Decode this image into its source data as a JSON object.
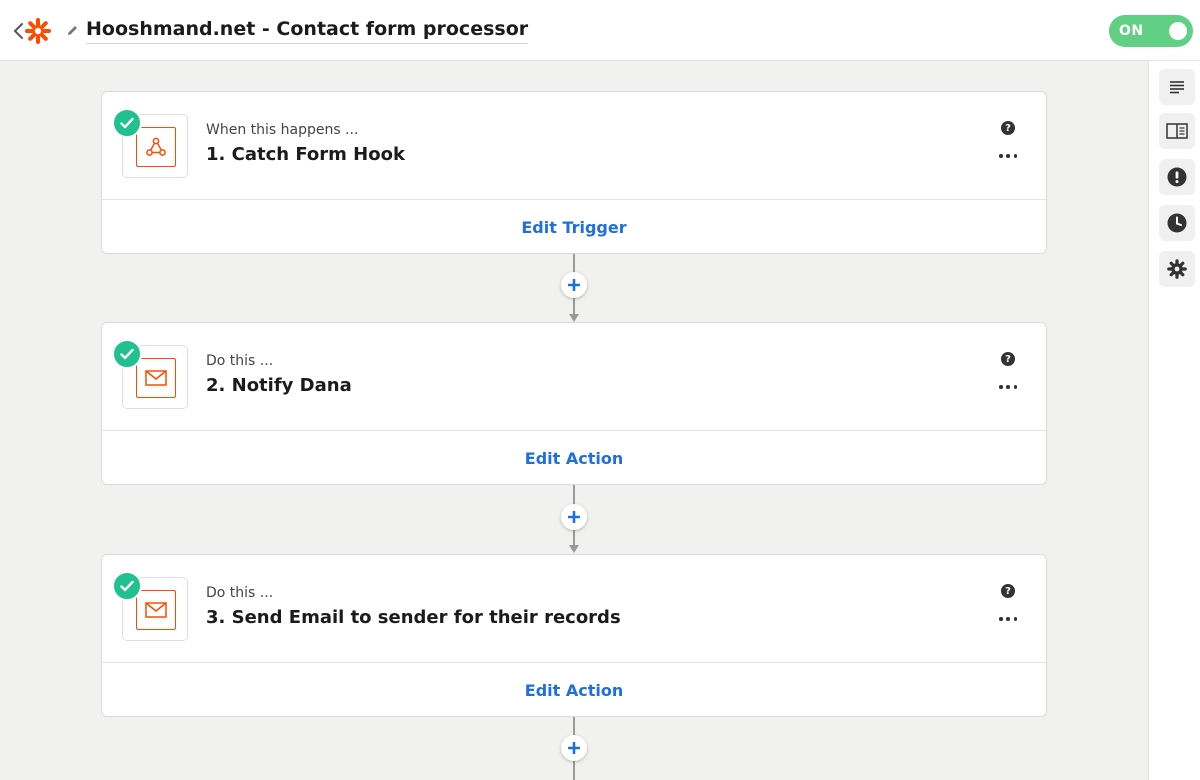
{
  "header": {
    "title": "Hooshmand.net - Contact form processor",
    "toggle_label": "ON"
  },
  "colors": {
    "brand": "#ff4a00",
    "link": "#1f6fe0",
    "toggle_on": "#61cf84",
    "check": "#21c18f"
  },
  "rail": {
    "icons": [
      "notes-icon",
      "guide-icon",
      "alert-icon",
      "history-icon",
      "settings-icon"
    ]
  },
  "steps": [
    {
      "kicker": "When this happens ...",
      "title": "1. Catch Form Hook",
      "icon": "webhook-icon",
      "edit_label": "Edit Trigger"
    },
    {
      "kicker": "Do this ...",
      "title": "2. Notify Dana",
      "icon": "email-icon",
      "edit_label": "Edit Action"
    },
    {
      "kicker": "Do this ...",
      "title": "3. Send Email to sender for their records",
      "icon": "email-icon",
      "edit_label": "Edit Action"
    }
  ],
  "help_glyph": "?"
}
